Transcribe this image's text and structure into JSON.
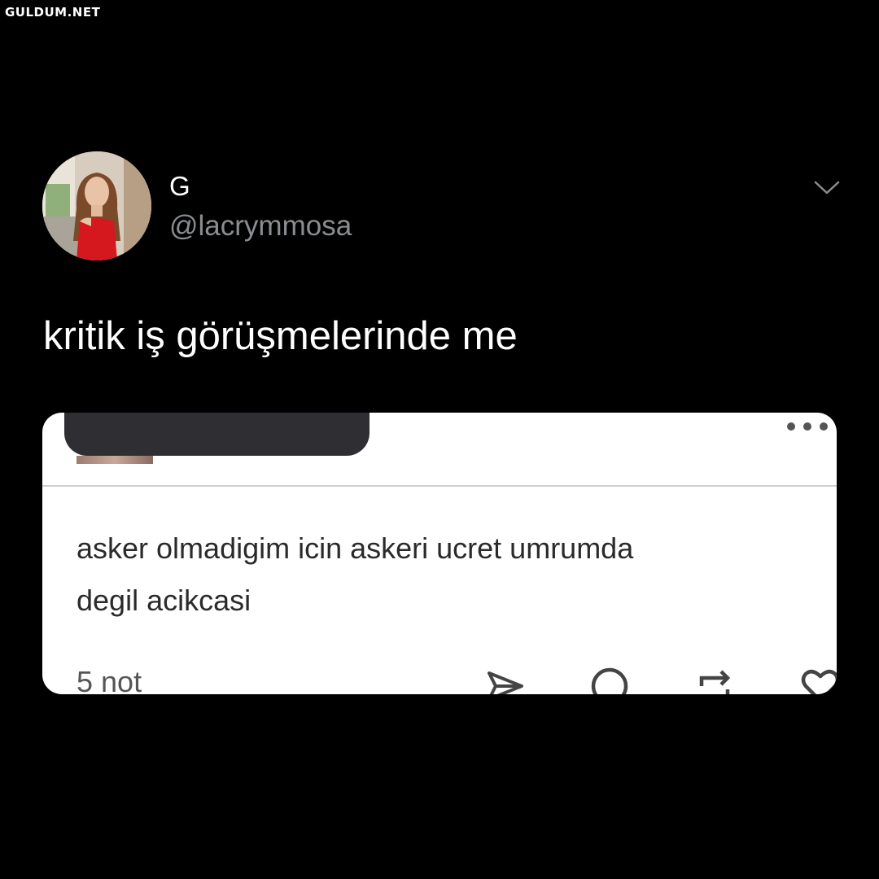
{
  "watermark": "GULDUM.NET",
  "author": {
    "display_name": "G",
    "handle": "@lacrymmosa",
    "avatar_icon": "profile-photo"
  },
  "tweet": {
    "text": "kritik iş görüşmelerinde me",
    "menu_icon": "chevron-down-icon"
  },
  "embedded_post": {
    "text": "asker olmadigim icin askeri ucret umrumda\ndegil acikcasi",
    "notes": "5 not",
    "menu_icon": "more-dots-icon",
    "actions": [
      "send-icon",
      "comment-icon",
      "reblog-icon",
      "heart-icon"
    ]
  },
  "colors": {
    "background": "#000000",
    "text_primary": "#ffffff",
    "text_secondary": "#8a8d91",
    "card_background": "#ffffff",
    "redaction": "#2f2f33"
  }
}
